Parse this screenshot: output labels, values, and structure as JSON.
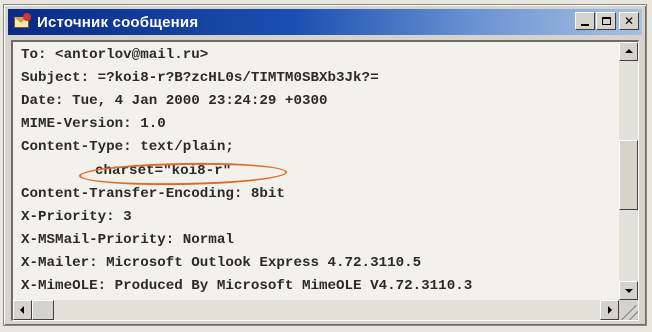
{
  "window": {
    "title": "Источник сообщения",
    "controls": {
      "minimize": "minimize",
      "maximize": "maximize",
      "close": "✕"
    }
  },
  "message_source": {
    "lines": [
      "To: <antorlov@mail.ru>",
      "Subject: =?koi8-r?B?zcHL0s/TIMTM0SBXb3Jk?=",
      "Date: Tue, 4 Jan 2000 23:24:29 +0300",
      "MIME-Version: 1.0",
      "Content-Type: text/plain;",
      "charset=\"koi8-r\"",
      "Content-Transfer-Encoding: 8bit",
      "X-Priority: 3",
      "X-MSMail-Priority: Normal",
      "X-Mailer: Microsoft Outlook Express 4.72.3110.5",
      "X-MimeOLE: Produced By Microsoft MimeOLE V4.72.3110.3"
    ],
    "highlighted_line": 5,
    "highlight_color": "#e06a2a"
  },
  "icons": {
    "app": "envelope-icon",
    "scroll_up": "arrow-up-icon",
    "scroll_down": "arrow-down-icon",
    "scroll_left": "arrow-left-icon",
    "scroll_right": "arrow-right-icon"
  },
  "colors": {
    "titlebar_start": "#0a2a86",
    "titlebar_end": "#a9c0e4",
    "text": "#2a2a2a"
  }
}
